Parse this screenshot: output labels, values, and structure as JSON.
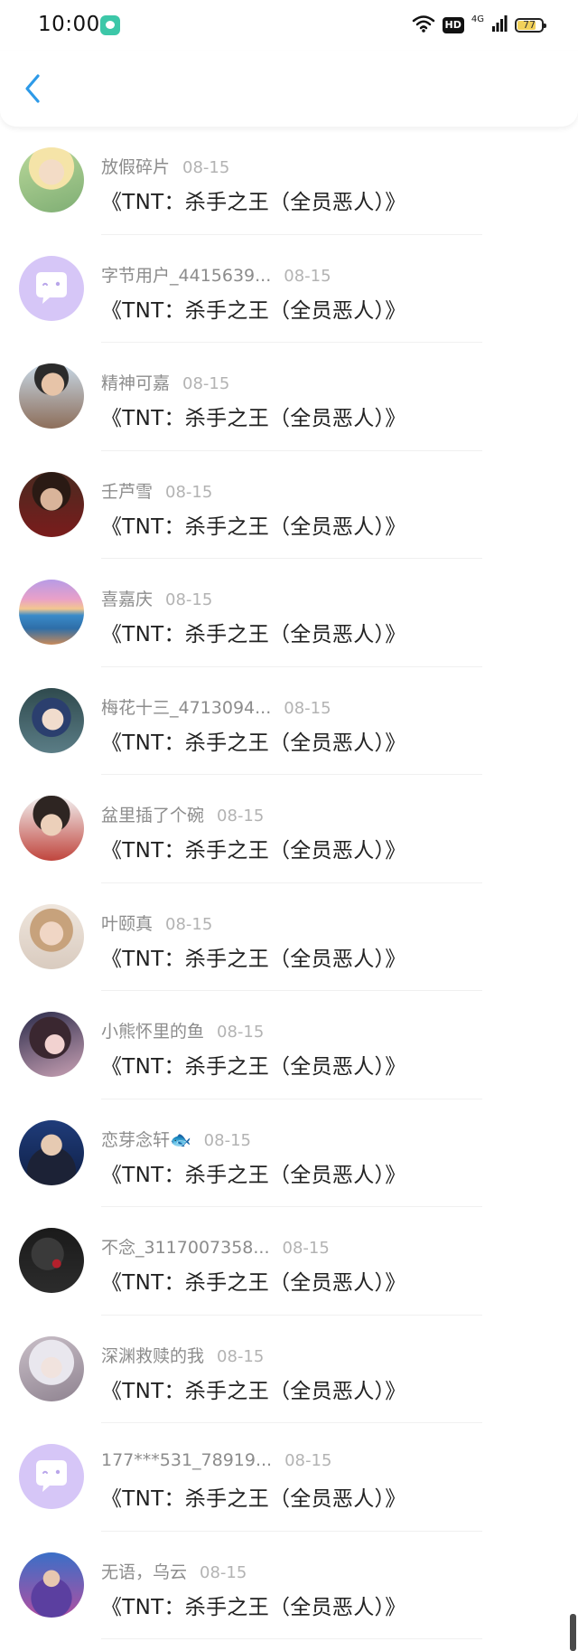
{
  "status_bar": {
    "time": "10:00",
    "network": "4G",
    "hd": "HD",
    "battery": 77
  },
  "list_title": "《TNT：杀手之王（全员恶人）》",
  "items": [
    {
      "name": "放假碎片",
      "date": "08-15",
      "avatar": "photo-blond-person"
    },
    {
      "name": "字节用户_4415639...",
      "date": "08-15",
      "avatar": "default-chat-bubble"
    },
    {
      "name": "精神可嘉",
      "date": "08-15",
      "avatar": "photo-person-with-guitar"
    },
    {
      "name": "壬芦雪",
      "date": "08-15",
      "avatar": "photo-dark-hair-person"
    },
    {
      "name": "喜嘉庆",
      "date": "08-15",
      "avatar": "painting-sunset-sea"
    },
    {
      "name": "梅花十三_4713094...",
      "date": "08-15",
      "avatar": "anime-girl-blue-hair"
    },
    {
      "name": "盆里插了个碗",
      "date": "08-15",
      "avatar": "photo-young-man"
    },
    {
      "name": "叶颐真",
      "date": "08-15",
      "avatar": "photo-girl-blond"
    },
    {
      "name": "小熊怀里的鱼",
      "date": "08-15",
      "avatar": "illustration-girl-dark-hair"
    },
    {
      "name": "恋芽念轩🐟",
      "date": "08-15",
      "avatar": "photo-man-dark-suit"
    },
    {
      "name": "不念_3117007358...",
      "date": "08-15",
      "avatar": "photo-dark-figure-rose"
    },
    {
      "name": "深渊救赎的我",
      "date": "08-15",
      "avatar": "illustration-white-hair"
    },
    {
      "name": "177***531_78919...",
      "date": "08-15",
      "avatar": "default-chat-bubble"
    },
    {
      "name": "无语，乌云",
      "date": "08-15",
      "avatar": "illustration-fantasy-figure"
    }
  ],
  "colors": {
    "accent": "#2d9ae8",
    "name_text": "#8c8c8c",
    "date_text": "#b3b3b3",
    "title_text": "#222222",
    "default_avatar_bg": "#d6c6f7"
  }
}
